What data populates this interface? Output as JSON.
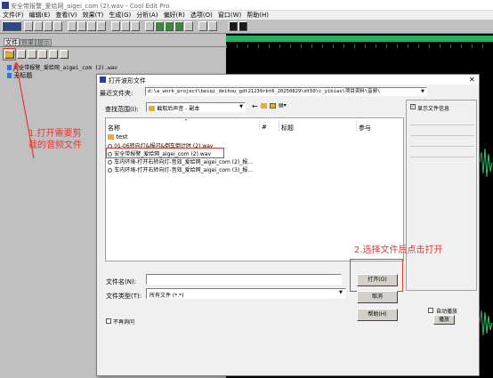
{
  "app": {
    "title": "安全带报警_爱给网_aigei_com (2).wav - Cool Edit Pro",
    "menu": [
      "文件(F)",
      "编辑(E)",
      "查看(V)",
      "效果(T)",
      "生成(G)",
      "分析(A)",
      "偏好(R)",
      "选项(O)",
      "窗口(W)",
      "帮助(H)"
    ]
  },
  "panel": {
    "tabs": [
      "文件",
      "效果",
      "提示"
    ],
    "files": [
      "安全带报警_爱给网_aigei_com (2).wav",
      "无标题"
    ]
  },
  "dialog": {
    "title": "打开波形文件",
    "recent_label": "最近文件夹:",
    "recent_value": "d:\\a_work_project\\beiqi_deihou_gdt21239rbt6_20250829\\dt50\\c_yibias\\项目资料\\音频\\",
    "lookin_label": "查找范围(I):",
    "lookin_value": "截取后声音 - 副本",
    "columns": [
      "名称",
      "#",
      "标题",
      "参与"
    ],
    "files": [
      {
        "name": "test",
        "type": "folder"
      },
      {
        "name": "01-06转向灯&报闪&倒车倒计时 (2).wav",
        "type": "wav"
      },
      {
        "name": "安全带报警_爱给网_aigei_com (2).wav",
        "type": "wav"
      },
      {
        "name": "车内环境-打开右转向灯-音效_爱给网_aigei_com (2)_报...",
        "type": "wav"
      },
      {
        "name": "车内环境-打开右转向灯-音效_爱给网_aigei_com (3)_报...",
        "type": "wav"
      }
    ],
    "filename_label": "文件名(N):",
    "filename_value": "",
    "filetype_label": "文件类型(T):",
    "filetype_value": "所有文件 (*.*)",
    "open_label": "打开(O)",
    "cancel_label": "取消",
    "help_label": "帮助(H)",
    "nocopy_label": "不再询问",
    "showinfo_label": "显示文件信息",
    "autoplay_label": "自动播放",
    "play_label": "播放"
  },
  "annotations": {
    "step1": "1.打开需要剪裁的音频文件",
    "step2": "2.选择文件后点击打开"
  },
  "colors": {
    "annotation": "#e53935",
    "waveform": "#2ecc71",
    "selection": "#cce8ff"
  }
}
